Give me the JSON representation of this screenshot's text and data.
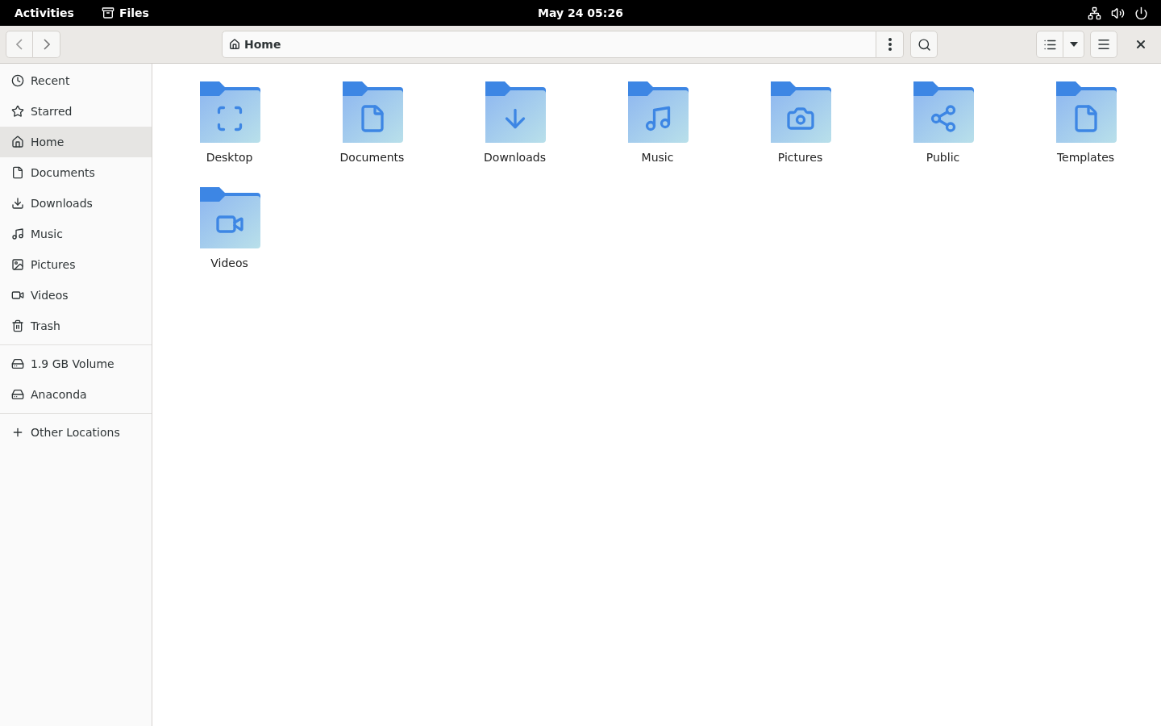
{
  "top_bar": {
    "activities": "Activities",
    "app_name": "Files",
    "clock": "May 24  05:26"
  },
  "header": {
    "path": "Home"
  },
  "sidebar": {
    "groups": [
      [
        {
          "label": "Recent",
          "selected": false
        },
        {
          "label": "Starred",
          "selected": false
        },
        {
          "label": "Home",
          "selected": true
        },
        {
          "label": "Documents",
          "selected": false
        },
        {
          "label": "Downloads",
          "selected": false
        },
        {
          "label": "Music",
          "selected": false
        },
        {
          "label": "Pictures",
          "selected": false
        },
        {
          "label": "Videos",
          "selected": false
        },
        {
          "label": "Trash",
          "selected": false
        }
      ],
      [
        {
          "label": "1.9 GB Volume",
          "selected": false
        },
        {
          "label": "Anaconda",
          "selected": false
        }
      ],
      [
        {
          "label": "Other Locations",
          "selected": false
        }
      ]
    ]
  },
  "files": [
    {
      "name": "Desktop"
    },
    {
      "name": "Documents"
    },
    {
      "name": "Downloads"
    },
    {
      "name": "Music"
    },
    {
      "name": "Pictures"
    },
    {
      "name": "Public"
    },
    {
      "name": "Templates"
    },
    {
      "name": "Videos"
    }
  ]
}
